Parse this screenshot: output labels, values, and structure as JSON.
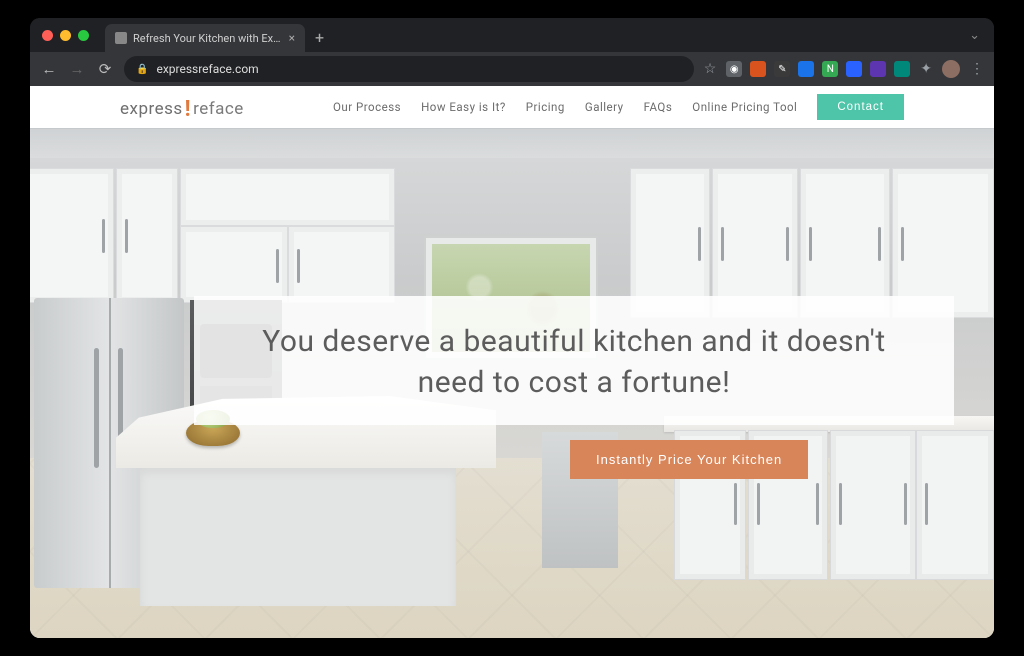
{
  "browser": {
    "tab": {
      "title": "Refresh Your Kitchen with Exp…"
    },
    "url": "expressreface.com"
  },
  "logo": {
    "part1": "express",
    "bang": "!",
    "part2": "reface"
  },
  "nav": {
    "items": [
      {
        "label": "Our Process"
      },
      {
        "label": "How Easy is It?"
      },
      {
        "label": "Pricing"
      },
      {
        "label": "Gallery"
      },
      {
        "label": "FAQs"
      },
      {
        "label": "Online Pricing Tool"
      }
    ],
    "contact_label": "Contact"
  },
  "hero": {
    "headline": "You deserve a beautiful kitchen and it doesn't need to cost a fortune!",
    "cta_label": "Instantly Price Your Kitchen"
  },
  "colors": {
    "accent_teal": "#4ec4a8",
    "accent_orange": "#d8855a",
    "logo_orange": "#e07a3f"
  }
}
